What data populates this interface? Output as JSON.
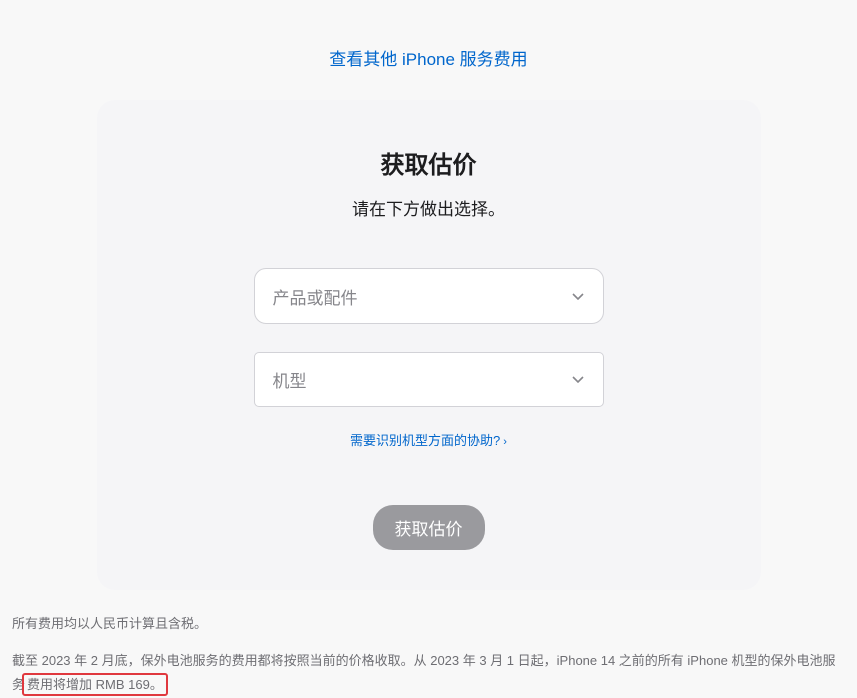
{
  "topLink": {
    "label": "查看其他 iPhone 服务费用"
  },
  "card": {
    "title": "获取估价",
    "subtitle": "请在下方做出选择。",
    "select1": {
      "placeholder": "产品或配件"
    },
    "select2": {
      "placeholder": "机型"
    },
    "helpLink": {
      "label": "需要识别机型方面的协助?"
    },
    "submit": {
      "label": "获取估价"
    }
  },
  "footnotes": {
    "line1": "所有费用均以人民币计算且含税。",
    "line2_part1": "截至 2023 年 2 月底，保外电池服务的费用都将按照当前的价格收取。从 2023 年 3 月 1 日起，iPhone 14 之前的所有 iPhone 机型的保外电池服务",
    "line2_highlight": "费用将增加 RMB 169。"
  }
}
